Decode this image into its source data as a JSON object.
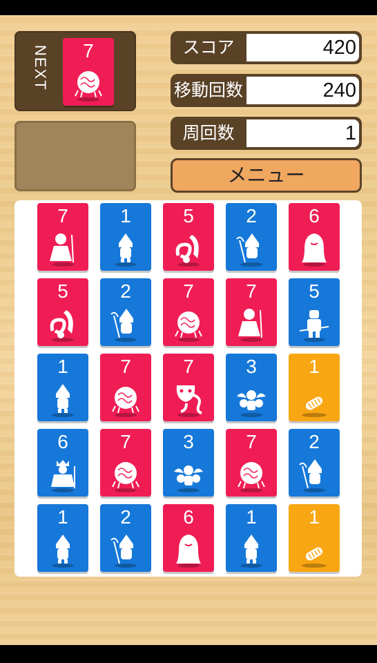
{
  "next": {
    "label": "NEXT",
    "card": {
      "value": "7",
      "color": "red",
      "icon": "brain-creature-icon"
    }
  },
  "stats": [
    {
      "label": "スコア",
      "value": "420"
    },
    {
      "label": "移動回数",
      "value": "240"
    },
    {
      "label": "周回数",
      "value": "1"
    }
  ],
  "menu_label": "メニュー",
  "colors": {
    "red": "#f01d55",
    "blue": "#1678d9",
    "orange": "#f8a612",
    "panel": "#5a4227"
  },
  "board": [
    [
      {
        "value": "7",
        "color": "red",
        "icon": "maid-with-broom-icon"
      },
      {
        "value": "1",
        "color": "blue",
        "icon": "hooded-villager-icon"
      },
      {
        "value": "5",
        "color": "red",
        "icon": "flaming-serpent-icon"
      },
      {
        "value": "2",
        "color": "blue",
        "icon": "hooded-scythe-icon"
      },
      {
        "value": "6",
        "color": "red",
        "icon": "long-haired-ghost-icon"
      }
    ],
    [
      {
        "value": "5",
        "color": "red",
        "icon": "flaming-serpent-icon"
      },
      {
        "value": "2",
        "color": "blue",
        "icon": "hooded-scythe-icon"
      },
      {
        "value": "7",
        "color": "red",
        "icon": "brain-creature-icon"
      },
      {
        "value": "7",
        "color": "red",
        "icon": "maid-with-broom-icon"
      },
      {
        "value": "5",
        "color": "blue",
        "icon": "armored-knight-icon"
      }
    ],
    [
      {
        "value": "1",
        "color": "blue",
        "icon": "hooded-villager-icon"
      },
      {
        "value": "7",
        "color": "red",
        "icon": "brain-creature-icon"
      },
      {
        "value": "7",
        "color": "red",
        "icon": "mask-tentacle-icon"
      },
      {
        "value": "3",
        "color": "blue",
        "icon": "winged-trio-icon"
      },
      {
        "value": "1",
        "color": "orange",
        "icon": "bread-item-icon"
      }
    ],
    [
      {
        "value": "6",
        "color": "blue",
        "icon": "crowned-king-icon"
      },
      {
        "value": "7",
        "color": "red",
        "icon": "brain-creature-icon"
      },
      {
        "value": "3",
        "color": "blue",
        "icon": "winged-trio-icon"
      },
      {
        "value": "7",
        "color": "red",
        "icon": "brain-creature-icon"
      },
      {
        "value": "2",
        "color": "blue",
        "icon": "hooded-scythe-icon"
      }
    ],
    [
      {
        "value": "1",
        "color": "blue",
        "icon": "hooded-villager-icon"
      },
      {
        "value": "2",
        "color": "blue",
        "icon": "hooded-scythe-icon"
      },
      {
        "value": "6",
        "color": "red",
        "icon": "long-haired-ghost-icon"
      },
      {
        "value": "1",
        "color": "blue",
        "icon": "hooded-villager-icon"
      },
      {
        "value": "1",
        "color": "orange",
        "icon": "bread-item-icon"
      }
    ]
  ]
}
